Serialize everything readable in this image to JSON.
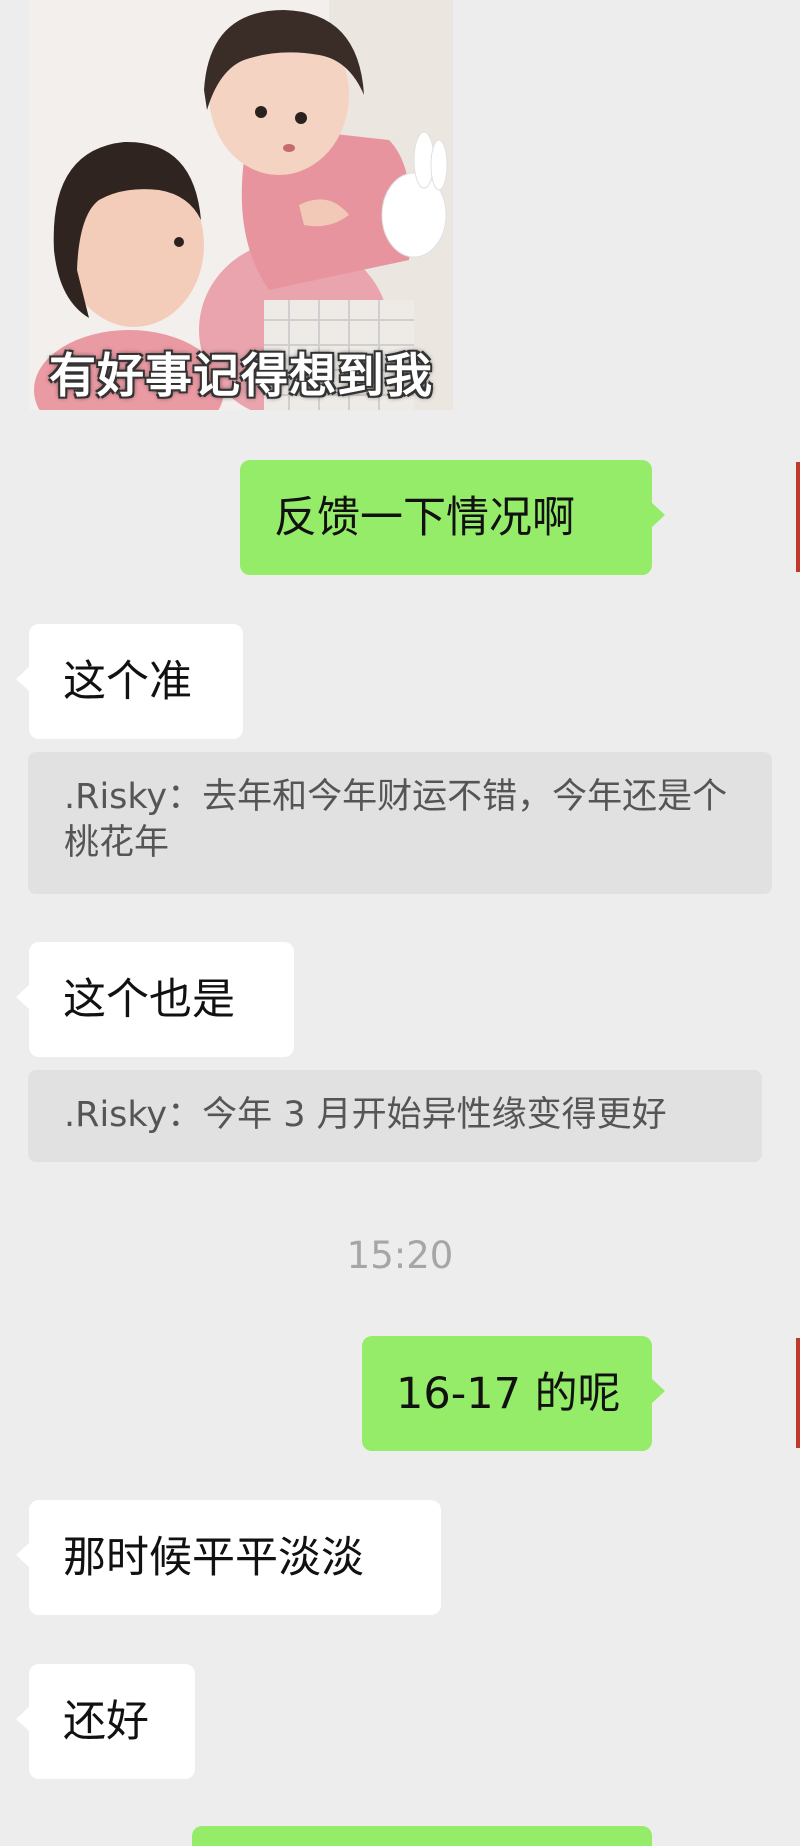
{
  "sticker": {
    "caption": "有好事记得想到我"
  },
  "messages": [
    {
      "side": "out",
      "text": "反馈一下情况啊"
    },
    {
      "side": "in",
      "text": "这个准"
    },
    {
      "type": "quote",
      "text": ".Risky：去年和今年财运不错，今年还是个桃花年"
    },
    {
      "side": "in",
      "text": "这个也是"
    },
    {
      "type": "quote",
      "text": ".Risky：今年 3 月开始异性缘变得更好"
    },
    {
      "type": "time",
      "text": "15:20"
    },
    {
      "side": "out",
      "text": "16-17 的呢"
    },
    {
      "side": "in",
      "text": "那时候平平淡淡"
    },
    {
      "side": "in",
      "text": "还好"
    }
  ],
  "colors": {
    "background": "#ededed",
    "bubble_in": "#ffffff",
    "bubble_out": "#95ec69",
    "quote_bg": "#e1e1e1",
    "time_text": "#a6a6a6"
  }
}
